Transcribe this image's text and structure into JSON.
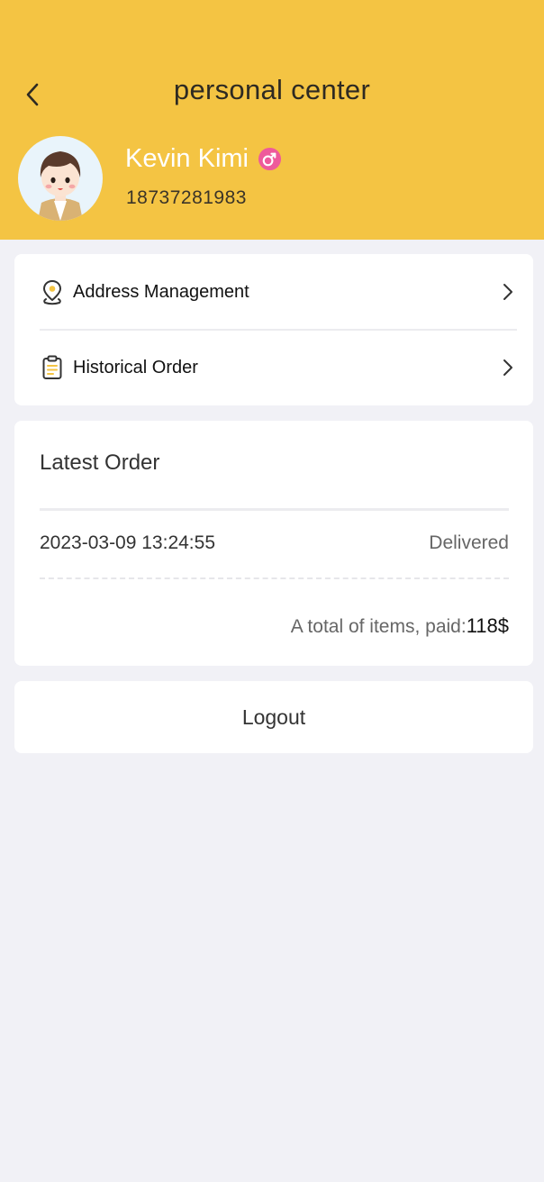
{
  "header": {
    "title": "personal center",
    "back_icon": "chevron-left-icon",
    "background_color": "#f4c443"
  },
  "profile": {
    "name": "Kevin Kimi",
    "phone": "18737281983",
    "gender_icon": "male-gender-icon",
    "gender_color": "#ee5a9b",
    "avatar": "cartoon-boy-avatar"
  },
  "menu": {
    "items": [
      {
        "label": "Address Management",
        "icon": "location-pin-icon"
      },
      {
        "label": "Historical Order",
        "icon": "clipboard-icon"
      }
    ],
    "chevron_icon": "chevron-right-icon"
  },
  "latest_order": {
    "title": "Latest Order",
    "datetime": "2023-03-09 13:24:55",
    "status": "Delivered",
    "total_prefix": "A total of items, paid:",
    "total_amount": "118$"
  },
  "logout": {
    "label": "Logout"
  }
}
